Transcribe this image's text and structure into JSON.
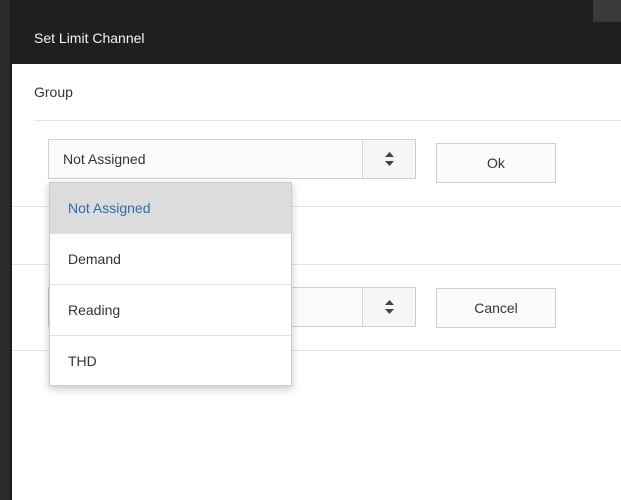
{
  "dialog": {
    "title": "Set Limit Channel",
    "group_label": "Group"
  },
  "group_select": {
    "value": "Not Assigned",
    "options": [
      {
        "label": "Not Assigned",
        "selected": true
      },
      {
        "label": "Demand",
        "selected": false
      },
      {
        "label": "Reading",
        "selected": false
      },
      {
        "label": "THD",
        "selected": false
      }
    ]
  },
  "second_select": {
    "value": ""
  },
  "buttons": {
    "ok_label": "Ok",
    "cancel_label": "Cancel"
  },
  "colors": {
    "titlebar": "#1f1f1f",
    "selected_option_text": "#2b6cb0",
    "selected_option_bg": "#dcdcdc"
  },
  "icons": {
    "select_arrows": "sort-up-down-icon"
  }
}
